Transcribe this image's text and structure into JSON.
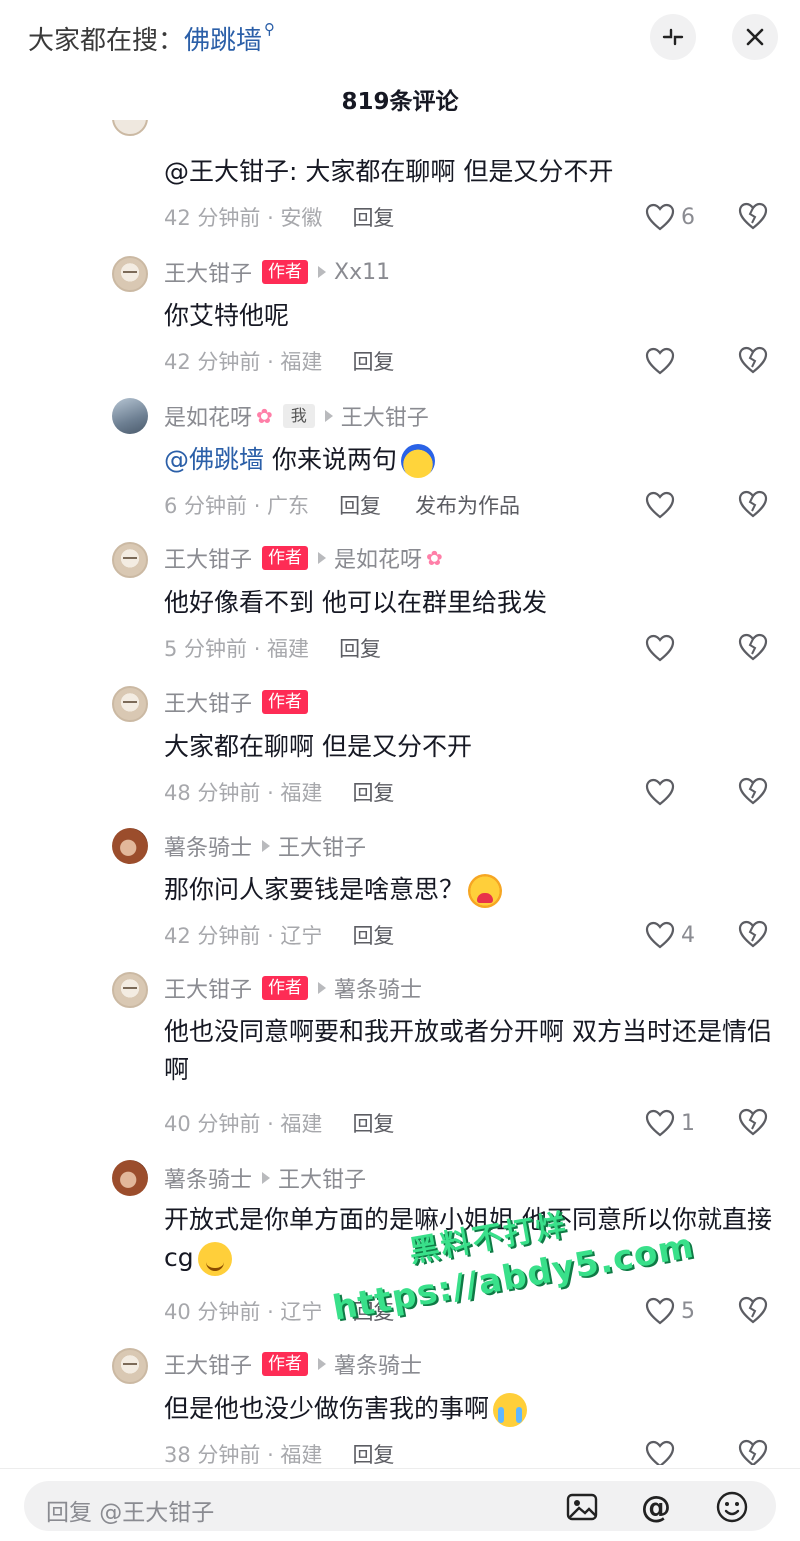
{
  "header": {
    "search_prefix": "大家都在搜：",
    "search_term": "佛跳墙",
    "comment_count": "819条评论"
  },
  "comments": [
    {
      "username": "",
      "text": "@王大钳子: 大家都在聊啊 但是又分不开",
      "time_location": "42 分钟前 · 安徽",
      "reply": "回复",
      "likes": "6"
    },
    {
      "username": "王大钳子",
      "tag": "作者",
      "reply_to": "Xx11",
      "text": "你艾特他呢",
      "time_location": "42 分钟前 · 福建",
      "reply": "回复",
      "likes": ""
    },
    {
      "username": "是如花呀",
      "tag": "我",
      "reply_to": "王大钳子",
      "mention": "@佛跳墙",
      "text": " 你来说两句",
      "time_location": "6 分钟前 · 广东",
      "reply": "回复",
      "publish": "发布为作品",
      "likes": ""
    },
    {
      "username": "王大钳子",
      "tag": "作者",
      "reply_to": "是如花呀",
      "text": "他好像看不到 他可以在群里给我发",
      "time_location": "5 分钟前 · 福建",
      "reply": "回复",
      "likes": ""
    },
    {
      "username": "王大钳子",
      "tag": "作者",
      "text": "大家都在聊啊 但是又分不开",
      "time_location": "48 分钟前 · 福建",
      "reply": "回复",
      "likes": ""
    },
    {
      "username": "薯条骑士",
      "reply_to": "王大钳子",
      "text": "那你问人家要钱是啥意思？",
      "time_location": "42 分钟前 · 辽宁",
      "reply": "回复",
      "likes": "4"
    },
    {
      "username": "王大钳子",
      "tag": "作者",
      "reply_to": "薯条骑士",
      "text": "他也没同意啊要和我开放或者分开啊 双方当时还是情侣啊",
      "time_location": "40 分钟前 · 福建",
      "reply": "回复",
      "likes": "1"
    },
    {
      "username": "薯条骑士",
      "reply_to": "王大钳子",
      "text": "开放式是你单方面的是嘛小姐姐 他不同意所以你就直接cg",
      "time_location": "40 分钟前 · 辽宁",
      "reply": "回复",
      "likes": "5"
    },
    {
      "username": "王大钳子",
      "tag": "作者",
      "reply_to": "薯条骑士",
      "text": "但是他也没少做伤害我的事啊",
      "time_location": "38 分钟前 · 福建",
      "reply": "回复",
      "likes": ""
    }
  ],
  "watermark": {
    "line1": "黑料不打烊",
    "line2": "https://abdy5.com"
  },
  "bottom": {
    "input_placeholder": "回复 @王大钳子"
  },
  "icons": {
    "search": "search-icon",
    "collapse": "collapse-icon",
    "close": "close-icon",
    "like": "heart-icon",
    "dislike": "broken-heart-icon",
    "image": "image-icon",
    "at": "at-icon",
    "emoji": "emoji-icon"
  },
  "colors": {
    "accent": "#fe2c55",
    "mention": "#2b5fa8",
    "muted": "#a7a8ac"
  }
}
